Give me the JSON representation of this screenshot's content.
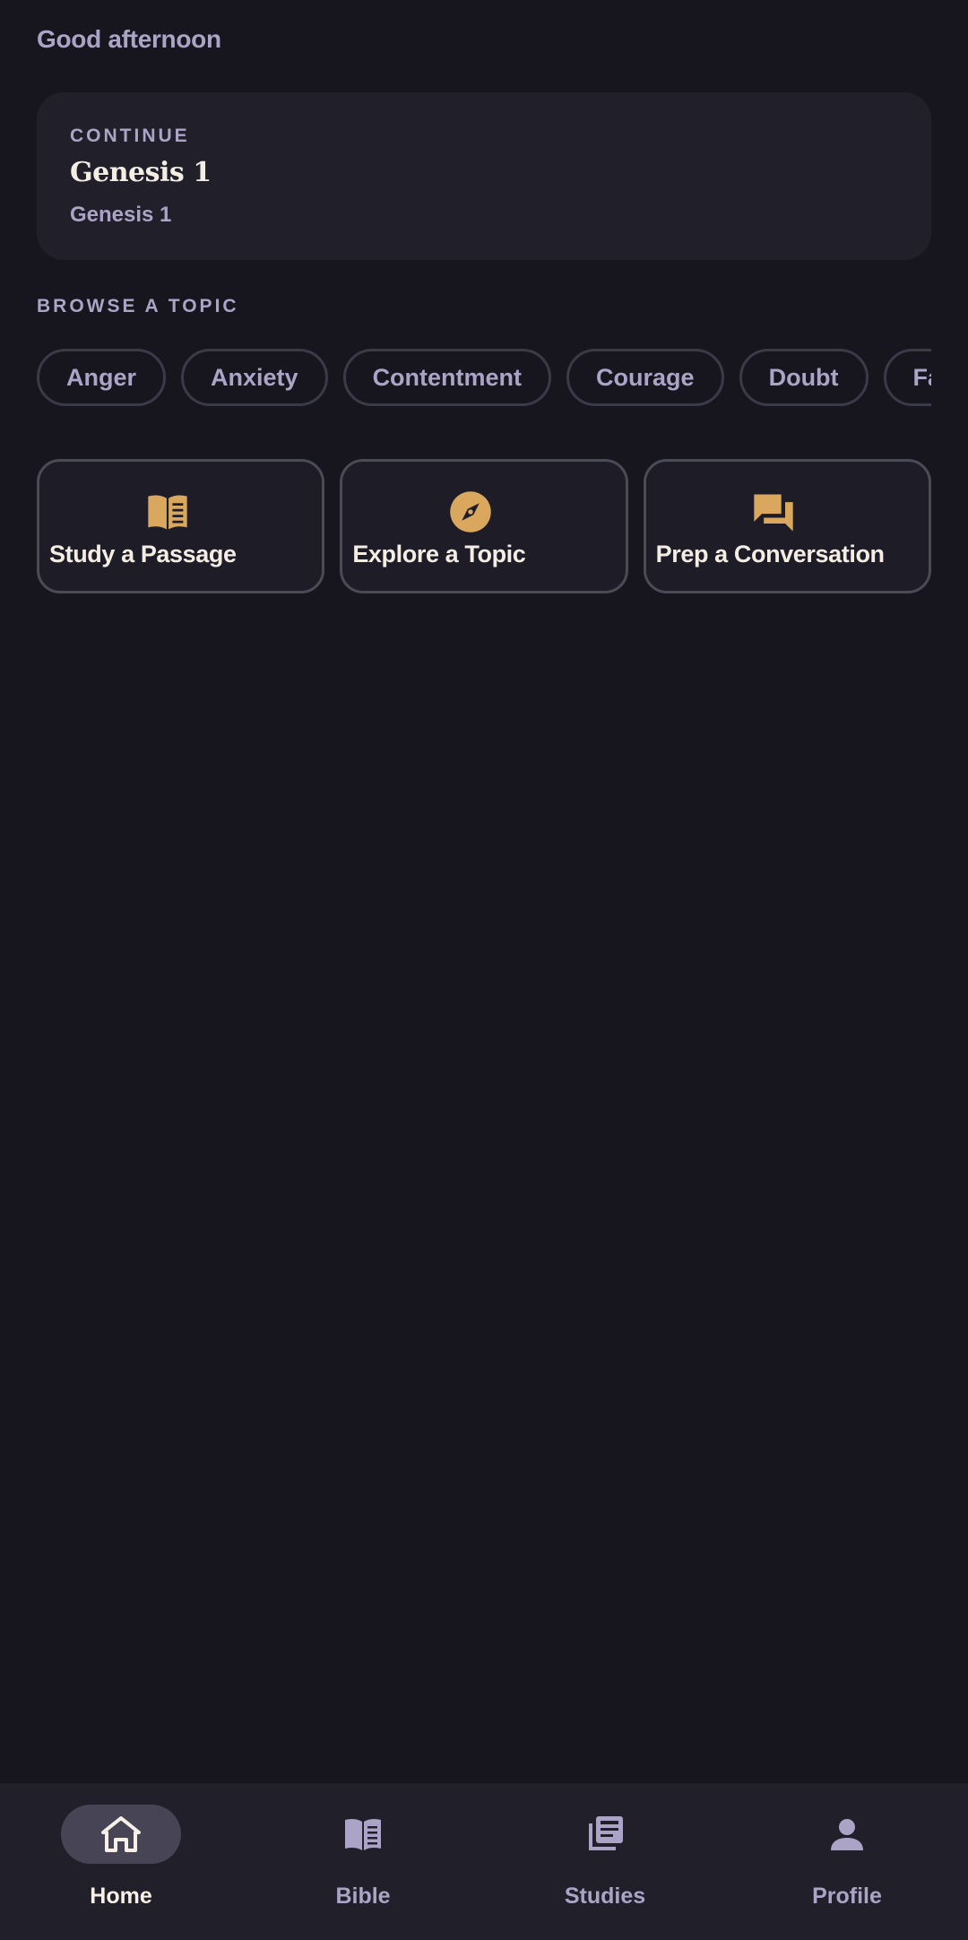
{
  "greeting": "Good afternoon",
  "continue": {
    "label": "CONTINUE",
    "title": "Genesis 1",
    "subtitle": "Genesis 1"
  },
  "topics": {
    "label": "BROWSE A TOPIC",
    "chips": [
      "Anger",
      "Anxiety",
      "Contentment",
      "Courage",
      "Doubt",
      "Faith"
    ]
  },
  "actions": [
    {
      "label": "Study a Passage",
      "icon": "book-open-icon"
    },
    {
      "label": "Explore a Topic",
      "icon": "compass-icon"
    },
    {
      "label": "Prep a Conversation",
      "icon": "chat-bubbles-icon"
    }
  ],
  "nav": {
    "items": [
      {
        "label": "Home",
        "icon": "home-icon",
        "active": true
      },
      {
        "label": "Bible",
        "icon": "book-icon",
        "active": false
      },
      {
        "label": "Studies",
        "icon": "library-icon",
        "active": false
      },
      {
        "label": "Profile",
        "icon": "person-icon",
        "active": false
      }
    ]
  },
  "colors": {
    "background": "#17161f",
    "card": "#201f2a",
    "accent": "#d9a85e",
    "muted_text": "#aba4c6",
    "primary_text": "#f3ede4"
  }
}
